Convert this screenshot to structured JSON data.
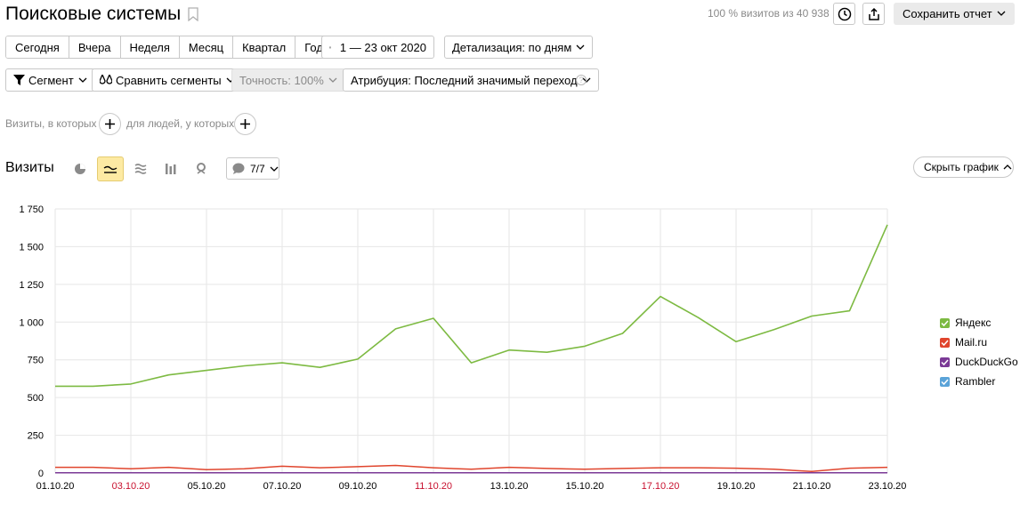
{
  "header": {
    "title": "Поисковые системы",
    "visits_info": "100 % визитов из 40 938",
    "save_report": "Сохранить отчет"
  },
  "periods": [
    "Сегодня",
    "Вчера",
    "Неделя",
    "Месяц",
    "Квартал",
    "Год"
  ],
  "date_range": "1 — 23 окт 2020",
  "detail": "Детализация: по дням",
  "segment": "Сегмент",
  "compare_segments": "Сравнить сегменты",
  "accuracy": "Точность: 100%",
  "attribution": "Атрибуция: Последний значимый переход",
  "help": "?",
  "filters": {
    "visits_label": "Визиты, в которых",
    "people_label": "для людей, у которых"
  },
  "section_title": "Визиты",
  "comments": "7/7",
  "hide_chart": "Скрыть график",
  "colors": {
    "yandex": "#7dba42",
    "mailru": "#e0452d",
    "duckduckgo": "#7b3a96",
    "rambler": "#5aa3d8",
    "holiday": "#c8102e"
  },
  "chart_data": {
    "type": "line",
    "x": [
      "01.10.20",
      "02.10.20",
      "03.10.20",
      "04.10.20",
      "05.10.20",
      "06.10.20",
      "07.10.20",
      "08.10.20",
      "09.10.20",
      "10.10.20",
      "11.10.20",
      "12.10.20",
      "13.10.20",
      "14.10.20",
      "15.10.20",
      "16.10.20",
      "17.10.20",
      "18.10.20",
      "19.10.20",
      "20.10.20",
      "21.10.20",
      "22.10.20",
      "23.10.20"
    ],
    "x_tick_labels": [
      "01.10.20",
      "03.10.20",
      "05.10.20",
      "07.10.20",
      "09.10.20",
      "11.10.20",
      "13.10.20",
      "15.10.20",
      "17.10.20",
      "19.10.20",
      "21.10.20",
      "23.10.20"
    ],
    "x_tick_weekend": [
      false,
      true,
      false,
      false,
      false,
      true,
      false,
      false,
      true,
      false,
      false,
      false
    ],
    "y_ticks": [
      0,
      250,
      500,
      750,
      1000,
      1250,
      1500,
      1750
    ],
    "y_tick_labels": [
      "0",
      "250",
      "500",
      "750",
      "1 000",
      "1 250",
      "1 500",
      "1 750"
    ],
    "ylim": [
      0,
      1750
    ],
    "grid": true,
    "legend_position": "right",
    "series": [
      {
        "name": "Яндекс",
        "color": "#7dba42",
        "values": [
          575,
          575,
          590,
          650,
          680,
          710,
          730,
          700,
          755,
          955,
          1025,
          730,
          815,
          800,
          840,
          925,
          1170,
          1030,
          870,
          950,
          1040,
          1075,
          1645
        ]
      },
      {
        "name": "Mail.ru",
        "color": "#e0452d",
        "values": [
          38,
          38,
          28,
          38,
          22,
          28,
          45,
          35,
          42,
          50,
          35,
          25,
          38,
          30,
          25,
          30,
          35,
          35,
          32,
          25,
          10,
          32,
          38
        ]
      },
      {
        "name": "DuckDuckGo",
        "color": "#7b3a96",
        "values": [
          2,
          2,
          2,
          2,
          2,
          2,
          2,
          2,
          2,
          2,
          2,
          2,
          2,
          2,
          2,
          2,
          2,
          2,
          2,
          2,
          2,
          2,
          2
        ]
      },
      {
        "name": "Rambler",
        "color": "#5aa3d8",
        "values": [
          1,
          1,
          1,
          1,
          1,
          1,
          1,
          1,
          1,
          1,
          1,
          1,
          1,
          1,
          1,
          1,
          1,
          1,
          1,
          1,
          1,
          1,
          1
        ]
      }
    ]
  }
}
